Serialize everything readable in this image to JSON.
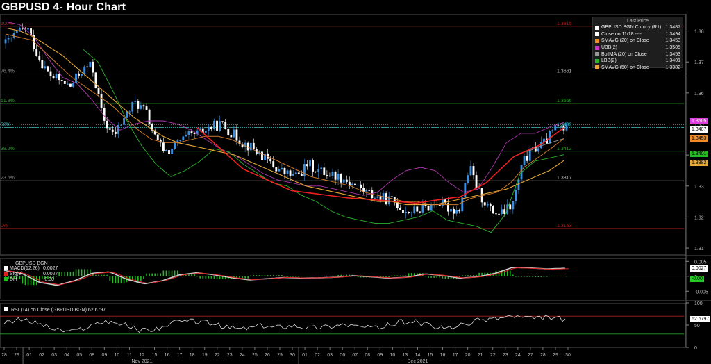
{
  "title": "GBPUSD 4- Hour Chart",
  "legend": {
    "header": "Last Price",
    "items": [
      {
        "label": "GBPUSD BGN Curncy  (R1)",
        "value": "1.3487",
        "color": "#ffffff"
      },
      {
        "label": "Close on 11/18 ----",
        "value": "1.3494",
        "color": "#ffffff"
      },
      {
        "label": "SMAVG (20)  on Close",
        "value": "1.3453",
        "color": "#f08a24"
      },
      {
        "label": "UBB(2)",
        "value": "1.3505",
        "color": "#cc33cc"
      },
      {
        "label": "BollMA (20)  on Close",
        "value": "1.3453",
        "color": "#999999"
      },
      {
        "label": "LBB(2)",
        "value": "1.3401",
        "color": "#2bb52b"
      },
      {
        "label": "SMAVG (50)  on Close",
        "value": "1.3382",
        "color": "#e8a838"
      }
    ]
  },
  "price_tags": [
    {
      "text": "1.3505",
      "bg": "#e040e0",
      "fg": "#fff"
    },
    {
      "text": "1.3487",
      "bg": "#ffffff",
      "fg": "#000"
    },
    {
      "text": "1.3453",
      "bg": "#f08a24",
      "fg": "#000"
    },
    {
      "text": "1.3401",
      "bg": "#22bb22",
      "fg": "#000"
    },
    {
      "text": "1.3382",
      "bg": "#e8a838",
      "fg": "#000"
    }
  ],
  "fib_levels": [
    {
      "pct": "100%",
      "value": "1.3815",
      "color": "#aa2222"
    },
    {
      "pct": "76.4%",
      "value": "1.3661",
      "color": "#888888"
    },
    {
      "pct": "61.8%",
      "value": "1.3566",
      "color": "#2a9a2a"
    },
    {
      "pct": "50%",
      "value": "1.3489",
      "color": "#33cccc"
    },
    {
      "pct": "38.2%",
      "value": "1.3412",
      "color": "#2a9a2a"
    },
    {
      "pct": "23.6%",
      "value": "1.3317",
      "color": "#888888"
    },
    {
      "pct": "0%",
      "value": "1.3163",
      "color": "#aa2222"
    }
  ],
  "macd_panel": {
    "title": "GBPUSD BGN",
    "items": [
      {
        "label": "MACD(12,26)",
        "value": "0.0027",
        "color": "#ffffff"
      },
      {
        "label": "Sig(9)",
        "value": "0.0027",
        "color": "#dd2222"
      },
      {
        "label": "Diff",
        "value": "-0.00",
        "color": "#22bb22"
      }
    ],
    "tags": [
      {
        "text": "0.0027",
        "bg": "#ffffff",
        "fg": "#000"
      },
      {
        "text": "-0.00",
        "bg": "#22cc22",
        "fg": "#000"
      }
    ]
  },
  "rsi_panel": {
    "label": "RSI (14)  on Close (GBPUSD BGN) 62.6797",
    "tag": {
      "text": "62.6797",
      "bg": "#ffffff",
      "fg": "#000"
    }
  },
  "chart_data": {
    "type": "candlestick",
    "title": "GBPUSD 4- Hour Chart",
    "price_axis": {
      "ticks": [
        "1.38",
        "1.37",
        "1.36",
        "1.35",
        "1.34",
        "1.33",
        "1.32",
        "1.31"
      ],
      "ylim": [
        1.308,
        1.3855
      ]
    },
    "macd_axis": {
      "ticks": [
        "0.005",
        "0",
        "-0.005"
      ],
      "ylim": [
        -0.0075,
        0.006
      ]
    },
    "rsi_axis": {
      "ticks": [
        "100",
        "50",
        "0"
      ],
      "ylim": [
        0,
        100
      ],
      "bands": [
        70,
        30
      ]
    },
    "x_axis": {
      "day_ticks": [
        "28",
        "29",
        "01",
        "02",
        "03",
        "04",
        "05",
        "08",
        "09",
        "10",
        "11",
        "12",
        "15",
        "16",
        "17",
        "18",
        "19",
        "22",
        "23",
        "24",
        "25",
        "26",
        "29",
        "30",
        "01",
        "02",
        "03",
        "06",
        "07",
        "08",
        "09",
        "10",
        "13",
        "14",
        "15",
        "16",
        "17",
        "20",
        "21",
        "22",
        "23",
        "24",
        "27",
        "28",
        "29",
        "30"
      ],
      "month_labels": [
        {
          "label": "Nov 2021",
          "at_index": 2
        },
        {
          "label": "Dec 2021",
          "at_index": 24
        }
      ]
    },
    "close_path": [
      1.376,
      1.379,
      1.381,
      1.372,
      1.366,
      1.364,
      1.362,
      1.367,
      1.369,
      1.352,
      1.346,
      1.352,
      1.357,
      1.354,
      1.344,
      1.341,
      1.344,
      1.346,
      1.347,
      1.349,
      1.35,
      1.347,
      1.344,
      1.342,
      1.339,
      1.336,
      1.334,
      1.333,
      1.337,
      1.335,
      1.334,
      1.333,
      1.331,
      1.329,
      1.327,
      1.326,
      1.325,
      1.322,
      1.322,
      1.323,
      1.325,
      1.323,
      1.322,
      1.336,
      1.327,
      1.322,
      1.321,
      1.324,
      1.338,
      1.342,
      1.344,
      1.349,
      1.3487
    ],
    "sma20_path": [
      1.379,
      1.378,
      1.377,
      1.373,
      1.369,
      1.365,
      1.362,
      1.359,
      1.356,
      1.352,
      1.348,
      1.345,
      1.344,
      1.344,
      1.345,
      1.346,
      1.346,
      1.345,
      1.343,
      1.341,
      1.339,
      1.337,
      1.335,
      1.333,
      1.332,
      1.331,
      1.33,
      1.328,
      1.327,
      1.326,
      1.325,
      1.325,
      1.324,
      1.324,
      1.324,
      1.326,
      1.327,
      1.328,
      1.331,
      1.336,
      1.339,
      1.342,
      1.3453
    ],
    "sma50_path": [
      1.381,
      1.38,
      1.378,
      1.375,
      1.372,
      1.368,
      1.364,
      1.36,
      1.356,
      1.352,
      1.349,
      1.346,
      1.344,
      1.343,
      1.342,
      1.341,
      1.34,
      1.338,
      1.336,
      1.334,
      1.332,
      1.33,
      1.329,
      1.328,
      1.327,
      1.326,
      1.325,
      1.325,
      1.324,
      1.324,
      1.324,
      1.325,
      1.326,
      1.327,
      1.328,
      1.329,
      1.331,
      1.333,
      1.335,
      1.3382
    ],
    "ubb_path": [
      1.383,
      1.382,
      1.378,
      1.371,
      1.365,
      1.363,
      1.358,
      1.352,
      1.348,
      1.35,
      1.351,
      1.351,
      1.35,
      1.348,
      1.345,
      1.342,
      1.34,
      1.337,
      1.334,
      1.332,
      1.331,
      1.33,
      1.33,
      1.329,
      1.328,
      1.327,
      1.328,
      1.332,
      1.335,
      1.336,
      1.335,
      1.331,
      1.328,
      1.329,
      1.336,
      1.344,
      1.347,
      1.347,
      1.349,
      1.3505
    ],
    "lbb_path": [
      1.374,
      1.37,
      1.361,
      1.351,
      1.343,
      1.337,
      1.333,
      1.335,
      1.338,
      1.342,
      1.341,
      1.337,
      1.334,
      1.331,
      1.33,
      1.327,
      1.325,
      1.322,
      1.32,
      1.319,
      1.318,
      1.318,
      1.319,
      1.32,
      1.322,
      1.319,
      1.318,
      1.317,
      1.315,
      1.321,
      1.334,
      1.338,
      1.339,
      1.3401
    ],
    "downtrend_line": [
      [
        1.3485,
        1.3487
      ],
      [
        1.3265,
        1.3252
      ]
    ],
    "uptrend_line": [
      [
        1.3245,
        1.3488
      ]
    ]
  }
}
